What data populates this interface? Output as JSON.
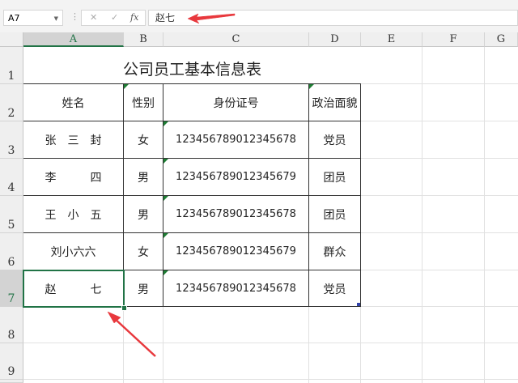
{
  "formula_bar": {
    "name_box": "A7",
    "cancel_icon": "✕",
    "enter_icon": "✓",
    "fx_label": "fx",
    "value": "赵七"
  },
  "columns": [
    "A",
    "B",
    "C",
    "D",
    "E",
    "F",
    "G"
  ],
  "rows": [
    "1",
    "2",
    "3",
    "4",
    "5",
    "6",
    "7",
    "8",
    "9"
  ],
  "title": "公司员工基本信息表",
  "headers": [
    "姓名",
    "性别",
    "身份证号",
    "政治面貌"
  ],
  "records": [
    [
      "张　三　封",
      "女",
      "123456789012345678",
      "党员"
    ],
    [
      "李　　　四",
      "男",
      "123456789012345679",
      "团员"
    ],
    [
      "王　小　五",
      "男",
      "123456789012345678",
      "团员"
    ],
    [
      "刘小六六",
      "女",
      "123456789012345679",
      "群众"
    ],
    [
      "赵　　　七",
      "男",
      "123456789012345678",
      "党员"
    ]
  ],
  "colors": {
    "accent": "#217346",
    "arrow": "#e8383d",
    "error_triangle": "#1e7e34"
  }
}
